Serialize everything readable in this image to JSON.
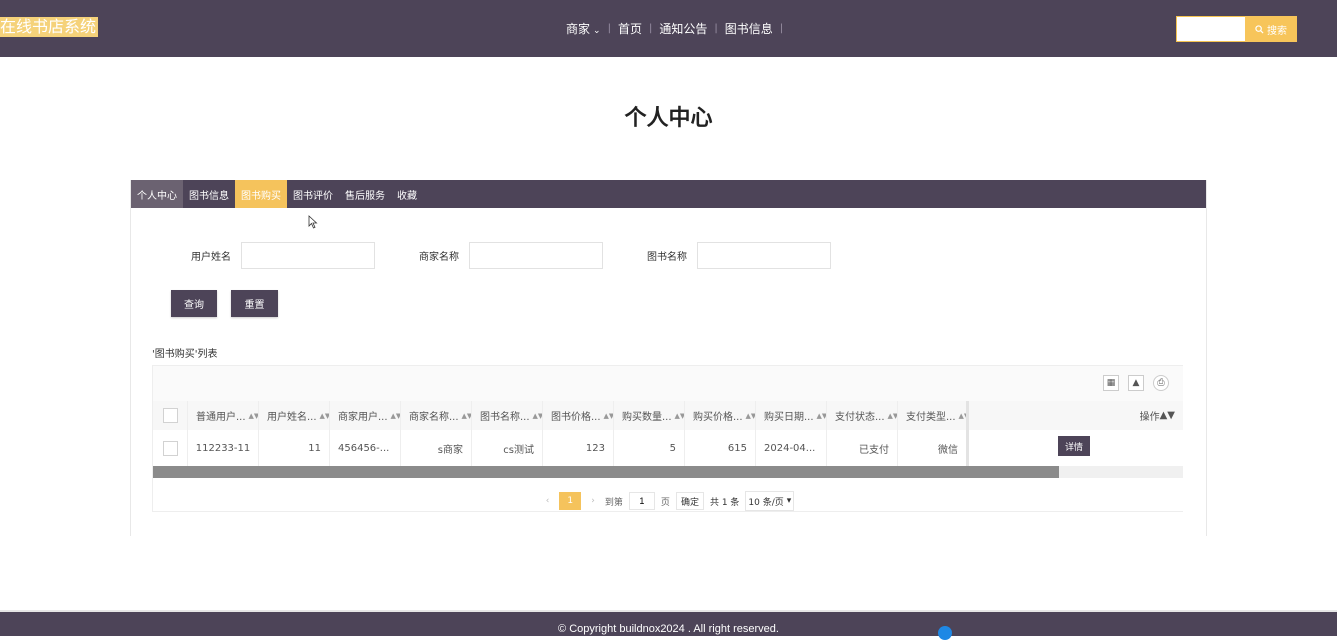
{
  "header": {
    "logo": "在线书店系统",
    "nav": [
      {
        "label": "商家",
        "has_dropdown": true
      },
      {
        "label": "首页"
      },
      {
        "label": "通知公告"
      },
      {
        "label": "图书信息"
      }
    ],
    "search": {
      "placeholder": "",
      "button_label": "搜索",
      "icon": "search-icon"
    }
  },
  "page_title": "个人中心",
  "tabs": [
    {
      "label": "个人中心"
    },
    {
      "label": "图书信息"
    },
    {
      "label": "图书购买",
      "active": true
    },
    {
      "label": "图书评价"
    },
    {
      "label": "售后服务"
    },
    {
      "label": "收藏"
    }
  ],
  "filters": [
    {
      "label": "用户姓名",
      "value": ""
    },
    {
      "label": "商家名称",
      "value": ""
    },
    {
      "label": "图书名称",
      "value": ""
    }
  ],
  "buttons": {
    "query": "查询",
    "reset": "重置"
  },
  "list_title": "'图书购买'列表",
  "toolbar_icons": [
    "columns-icon",
    "export-icon",
    "print-icon"
  ],
  "table": {
    "columns": [
      "普通用户...",
      "用户姓名...",
      "商家用户...",
      "商家名称...",
      "图书名称...",
      "图书价格...",
      "购买数量...",
      "购买价格...",
      "购买日期...",
      "支付状态...",
      "支付类型..."
    ],
    "op_label": "操作",
    "rows": [
      {
        "cells": [
          "112233-11",
          "11",
          "456456-...",
          "s商家",
          "cs测试",
          "123",
          "5",
          "615",
          "2024-04...",
          "已支付",
          "微信"
        ],
        "action": "详情"
      }
    ],
    "scroll_fraction": 0.88
  },
  "pager": {
    "current": "1",
    "goto_label": "到第",
    "goto_value": "1",
    "page_unit": "页",
    "confirm": "确定",
    "total": "共 1 条",
    "page_size": "10 条/页"
  },
  "footer": {
    "copyright": "© Copyright buildnox2024 . All right reserved."
  },
  "colors": {
    "primary": "#4d4458",
    "accent": "#f5c35c"
  }
}
